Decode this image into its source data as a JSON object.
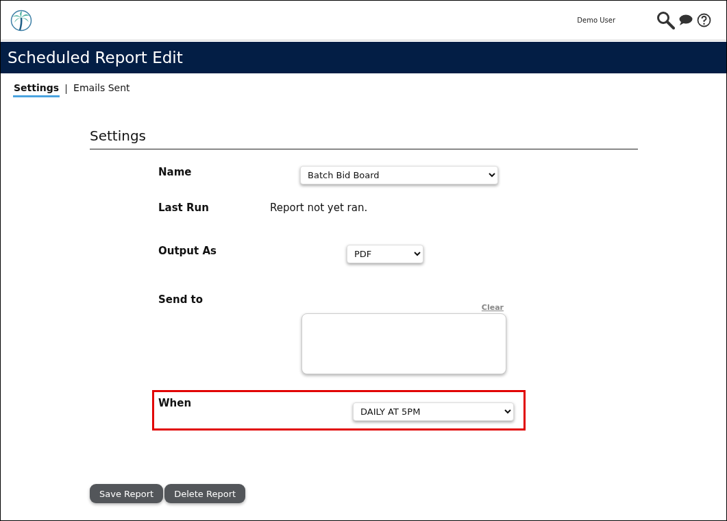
{
  "header": {
    "user": "Demo User"
  },
  "title": "Scheduled Report Edit",
  "tabs": [
    {
      "label": "Settings",
      "selected": true
    },
    {
      "label": "Emails Sent",
      "selected": false
    }
  ],
  "section_title": "Settings",
  "fields": [
    {
      "kind": "select",
      "label": "Name",
      "value": "Batch Bid Board",
      "highlighted": false
    },
    {
      "kind": "text",
      "label": "Last Run",
      "value": "Report not yet ran.",
      "highlighted": false
    },
    {
      "kind": "select",
      "label": "Output As",
      "value": "PDF",
      "highlighted": false
    },
    {
      "kind": "textarea",
      "label": "Send to",
      "link": "Clear",
      "highlighted": false
    },
    {
      "kind": "select",
      "label": "When",
      "value": "DAILY AT 5PM",
      "highlighted": true
    }
  ],
  "buttons": [
    "Save Report",
    "Delete Report"
  ]
}
